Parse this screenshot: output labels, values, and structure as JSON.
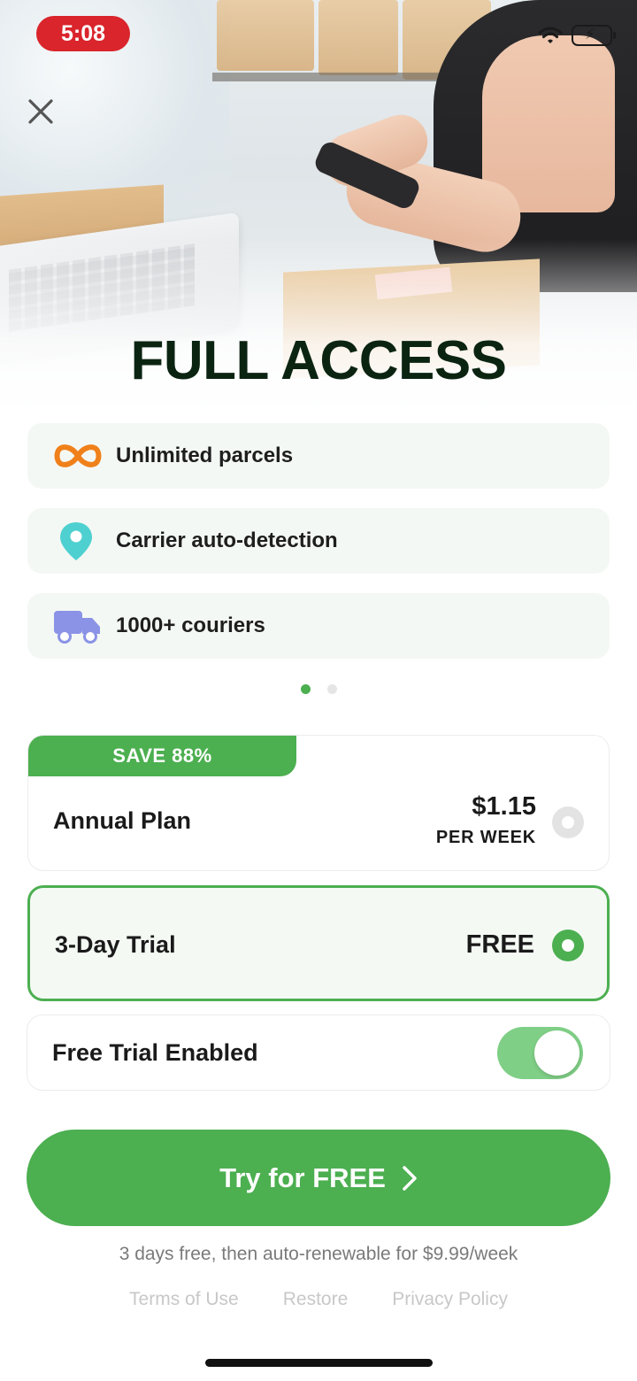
{
  "status_bar": {
    "time": "5:08"
  },
  "title": "FULL ACCESS",
  "features": [
    {
      "label": "Unlimited parcels",
      "icon": "infinity-icon",
      "color": "#f0801a"
    },
    {
      "label": "Carrier auto-detection",
      "icon": "location-pin-icon",
      "color": "#4fd0d0"
    },
    {
      "label": "1000+ couriers",
      "icon": "truck-icon",
      "color": "#8a93e6"
    }
  ],
  "pager": {
    "total": 2,
    "active": 1
  },
  "plans": {
    "annual": {
      "badge": "SAVE 88%",
      "name": "Annual Plan",
      "price": "$1.15",
      "unit": "PER WEEK",
      "selected": false
    },
    "trial": {
      "name": "3-Day Trial",
      "price": "FREE",
      "selected": true
    }
  },
  "trial_toggle": {
    "label": "Free Trial Enabled",
    "enabled": true
  },
  "cta": {
    "label": "Try for FREE"
  },
  "renew_note": "3 days free, then auto-renewable for $9.99/week",
  "footer": {
    "terms": "Terms of Use",
    "restore": "Restore",
    "privacy": "Privacy Policy"
  },
  "colors": {
    "accent": "#4caf50",
    "title": "#0b2412",
    "status_pill": "#d9252b"
  }
}
